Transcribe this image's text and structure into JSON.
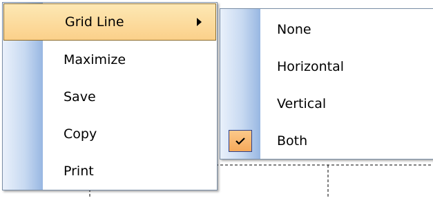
{
  "context_menu": {
    "items": [
      {
        "label": "Grid Line",
        "has_submenu": true,
        "highlighted": true
      },
      {
        "label": "Maximize"
      },
      {
        "label": "Save"
      },
      {
        "label": "Copy"
      },
      {
        "label": "Print"
      }
    ]
  },
  "grid_line_submenu": {
    "items": [
      {
        "label": "None"
      },
      {
        "label": "Horizontal"
      },
      {
        "label": "Vertical"
      },
      {
        "label": "Both",
        "checked": true
      }
    ]
  },
  "icons": {
    "submenu_arrow": "chevron-right-icon",
    "check": "checkmark-icon"
  },
  "colors": {
    "highlight": "#fbd08a",
    "check_bg": "#f5a95a",
    "gutter": "#98b7e2",
    "menu_border": "#7a8ea6"
  }
}
